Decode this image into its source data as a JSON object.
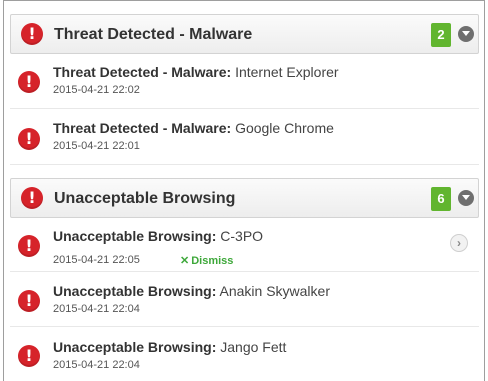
{
  "groups": [
    {
      "title": "Threat Detected - Malware",
      "count": "2",
      "items": [
        {
          "prefix": "Threat Detected - Malware:",
          "name": "Internet Explorer",
          "time": "2015-04-21 22:02"
        },
        {
          "prefix": "Threat Detected - Malware:",
          "name": "Google Chrome",
          "time": "2015-04-21 22:01"
        }
      ]
    },
    {
      "title": "Unacceptable Browsing",
      "count": "6",
      "items": [
        {
          "prefix": "Unacceptable Browsing:",
          "name": "C-3PO",
          "time": "2015-04-21 22:05",
          "dismiss_label": "Dismiss"
        },
        {
          "prefix": "Unacceptable Browsing:",
          "name": "Anakin Skywalker",
          "time": "2015-04-21 22:04"
        },
        {
          "prefix": "Unacceptable Browsing:",
          "name": "Jango Fett",
          "time": "2015-04-21 22:04"
        }
      ]
    }
  ],
  "icons": {
    "alert": "exclamation-circle-icon",
    "collapse": "chevron-down-circle-icon",
    "details": "chevron-right-circle-icon",
    "dismiss": "x-icon"
  },
  "colors": {
    "alert_red": "#d6232a",
    "badge_green": "#61b52f",
    "dismiss_green": "#3ea83a"
  }
}
